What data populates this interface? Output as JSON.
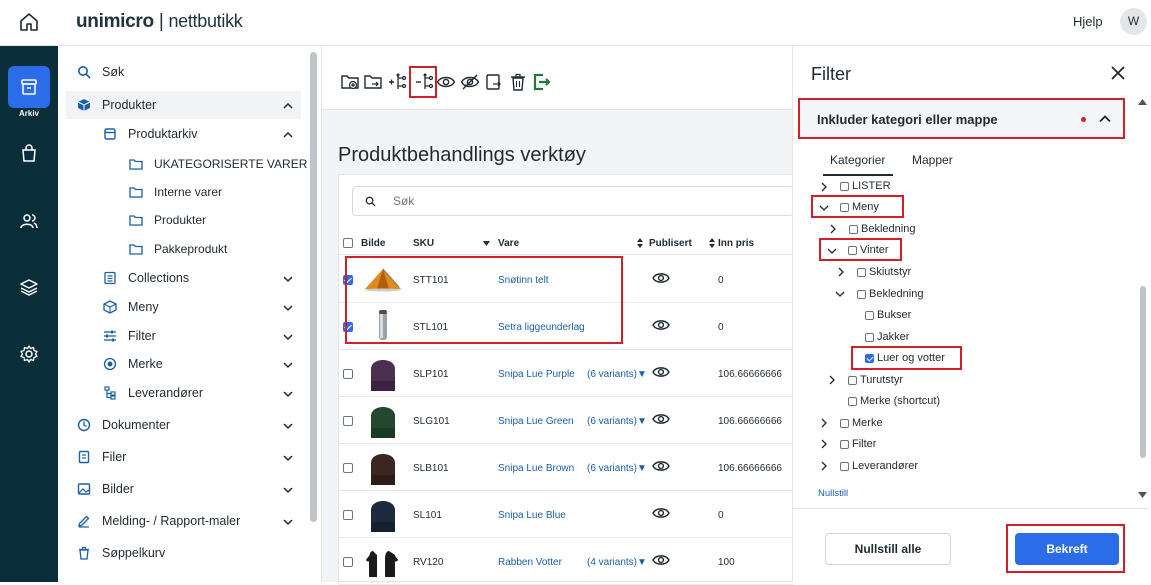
{
  "header": {
    "brand": "unimicro",
    "brand_suffix": "nettbutikk",
    "help": "Hjelp",
    "avatar": "W"
  },
  "rail": {
    "active_label": "Arkiv"
  },
  "nav": {
    "items": [
      {
        "label": "Søk",
        "icon": "search-icon"
      },
      {
        "label": "Produkter",
        "icon": "box-icon"
      },
      {
        "label": "Produktarkiv",
        "icon": "archive-icon"
      },
      {
        "label": "UKATEGORISERTE VARER",
        "icon": "folder-icon"
      },
      {
        "label": "Interne varer",
        "icon": "folder-icon"
      },
      {
        "label": "Produkter",
        "icon": "folder-icon"
      },
      {
        "label": "Pakkeprodukt",
        "icon": "folder-icon"
      },
      {
        "label": "Collections",
        "icon": "list-icon"
      },
      {
        "label": "Meny",
        "icon": "box-icon"
      },
      {
        "label": "Filter",
        "icon": "sliders-icon"
      },
      {
        "label": "Merke",
        "icon": "badge-icon"
      },
      {
        "label": "Leverandører",
        "icon": "tree-icon"
      },
      {
        "label": "Dokumenter",
        "icon": "doc-icon"
      },
      {
        "label": "Filer",
        "icon": "file-icon"
      },
      {
        "label": "Bilder",
        "icon": "image-icon"
      },
      {
        "label": "Melding- / Rapport-maler",
        "icon": "edit-icon"
      },
      {
        "label": "Søppelkurv",
        "icon": "trash-icon"
      }
    ]
  },
  "main": {
    "title": "Produktbehandlings verktøy",
    "search_placeholder": "Søk",
    "columns": {
      "image": "Bilde",
      "sku": "SKU",
      "vare": "Vare",
      "publisert": "Publisert",
      "pris": "Inn pris"
    },
    "rows": [
      {
        "sku": "STT101",
        "vare": "Snøtinn telt",
        "variants": "",
        "pris": "0",
        "checked": true,
        "thumb": "tent"
      },
      {
        "sku": "STL101",
        "vare": "Setra liggeunderlag",
        "variants": "",
        "pris": "0",
        "checked": true,
        "thumb": "pad"
      },
      {
        "sku": "SLP101",
        "vare": "Snipa Lue Purple",
        "variants": "(6 variants)▼",
        "pris": "106.66666666",
        "checked": false,
        "thumb": "#4a2f4f"
      },
      {
        "sku": "SLG101",
        "vare": "Snipa Lue Green",
        "variants": "(6 variants)▼",
        "pris": "106.66666666",
        "checked": false,
        "thumb": "#24472f"
      },
      {
        "sku": "SLB101",
        "vare": "Snipa Lue Brown",
        "variants": "(6 variants)▼",
        "pris": "106.66666666",
        "checked": false,
        "thumb": "#3c2622"
      },
      {
        "sku": "SL101",
        "vare": "Snipa Lue Blue",
        "variants": "",
        "pris": "0",
        "checked": false,
        "thumb": "#1e2a3d"
      },
      {
        "sku": "RV120",
        "vare": "Rabben Votter",
        "variants": "(4 variants)▼",
        "pris": "100",
        "checked": false,
        "thumb": "gloves"
      }
    ]
  },
  "filter": {
    "title": "Filter",
    "section_title": "Inkluder kategori eller mappe",
    "tabs": [
      "Kategorier",
      "Mapper"
    ],
    "tree": [
      {
        "label": "LISTER",
        "checked": false,
        "chevron": "right"
      },
      {
        "label": "Meny",
        "checked": false,
        "chevron": "down"
      },
      {
        "label": "Bekledning",
        "checked": false,
        "chevron": "right"
      },
      {
        "label": "Vinter",
        "checked": false,
        "chevron": "down"
      },
      {
        "label": "Skiutstyr",
        "checked": false,
        "chevron": "right"
      },
      {
        "label": "Bekledning",
        "checked": false,
        "chevron": "down"
      },
      {
        "label": "Bukser",
        "checked": false,
        "chevron": ""
      },
      {
        "label": "Jakker",
        "checked": false,
        "chevron": ""
      },
      {
        "label": "Luer og votter",
        "checked": true,
        "chevron": ""
      },
      {
        "label": "Turutstyr",
        "checked": false,
        "chevron": "right"
      },
      {
        "label": "Merke (shortcut)",
        "checked": false,
        "chevron": ""
      },
      {
        "label": "Merke",
        "checked": false,
        "chevron": "right"
      },
      {
        "label": "Filter",
        "checked": false,
        "chevron": "right"
      },
      {
        "label": "Leverandører",
        "checked": false,
        "chevron": "right"
      }
    ],
    "reset_link": "Nullstill",
    "reset_all": "Nullstill alle",
    "confirm": "Bekreft"
  },
  "colors": {
    "rail": "#0b2f3a",
    "accent": "#2b6de8",
    "highlight": "#d0202a"
  }
}
